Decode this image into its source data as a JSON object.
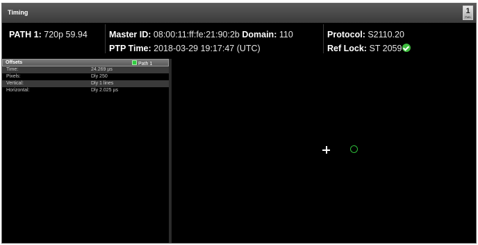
{
  "window": {
    "title": "Timing",
    "icon_button": {
      "main": "1",
      "sub": "Path"
    }
  },
  "info": {
    "path_label": "PATH 1:",
    "path_value": "720p 59.94",
    "master_label": "Master ID:",
    "master_value": "08:00:11:ff:fe:21:90:2b",
    "domain_label": "Domain:",
    "domain_value": "110",
    "ptp_label": "PTP Time:",
    "ptp_value": "2018-03-29 19:17:47 (UTC)",
    "protocol_label": "Protocol:",
    "protocol_value": "S2110.20",
    "reflock_label": "Ref Lock:",
    "reflock_value": "ST 2059"
  },
  "offsets": {
    "title": "Offsets",
    "path_badge": "Path 1",
    "rows": [
      {
        "key": "Time:",
        "value": "24.269 µs"
      },
      {
        "key": "Pixels:",
        "value": "Dly 250"
      },
      {
        "key": "Vertical:",
        "value": "Dly 1 lines"
      },
      {
        "key": "Horizontal:",
        "value": "Dly 2.025 µs"
      }
    ]
  },
  "colors": {
    "status_ok": "#3fbf3f",
    "ring": "#2ebd3a",
    "background": "#000000"
  }
}
